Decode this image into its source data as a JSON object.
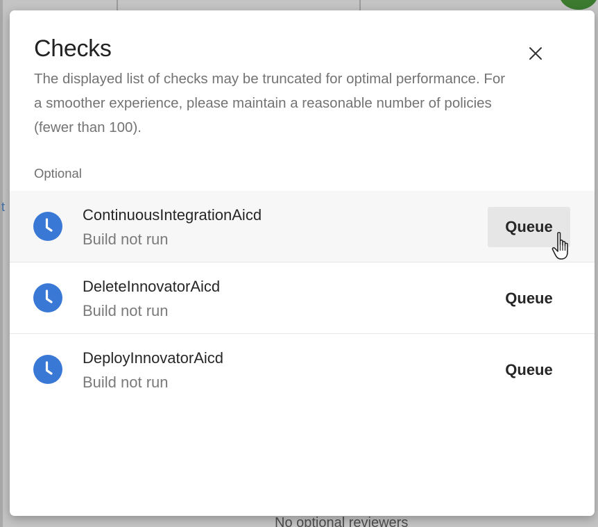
{
  "background": {
    "footer_text": "No optional reviewers",
    "link_fragment": "t"
  },
  "dialog": {
    "title": "Checks",
    "close_icon": "close-icon",
    "subtitle": "The displayed list of checks may be truncated for optimal performance. For a smoother experience, please maintain a reasonable number of policies (fewer than 100).",
    "section_label": "Optional",
    "checks": [
      {
        "name": "ContinuousIntegrationAicd",
        "status": "Build not run",
        "action": "Queue",
        "icon": "clock-icon",
        "hovered": true
      },
      {
        "name": "DeleteInnovatorAicd",
        "status": "Build not run",
        "action": "Queue",
        "icon": "clock-icon",
        "hovered": false
      },
      {
        "name": "DeployInnovatorAicd",
        "status": "Build not run",
        "action": "Queue",
        "icon": "clock-icon",
        "hovered": false
      }
    ]
  },
  "colors": {
    "status_icon": "#3a78d6",
    "hover_row": "#f7f7f7",
    "hover_button": "#e6e6e6"
  },
  "cursor": "hand-pointer-cursor"
}
